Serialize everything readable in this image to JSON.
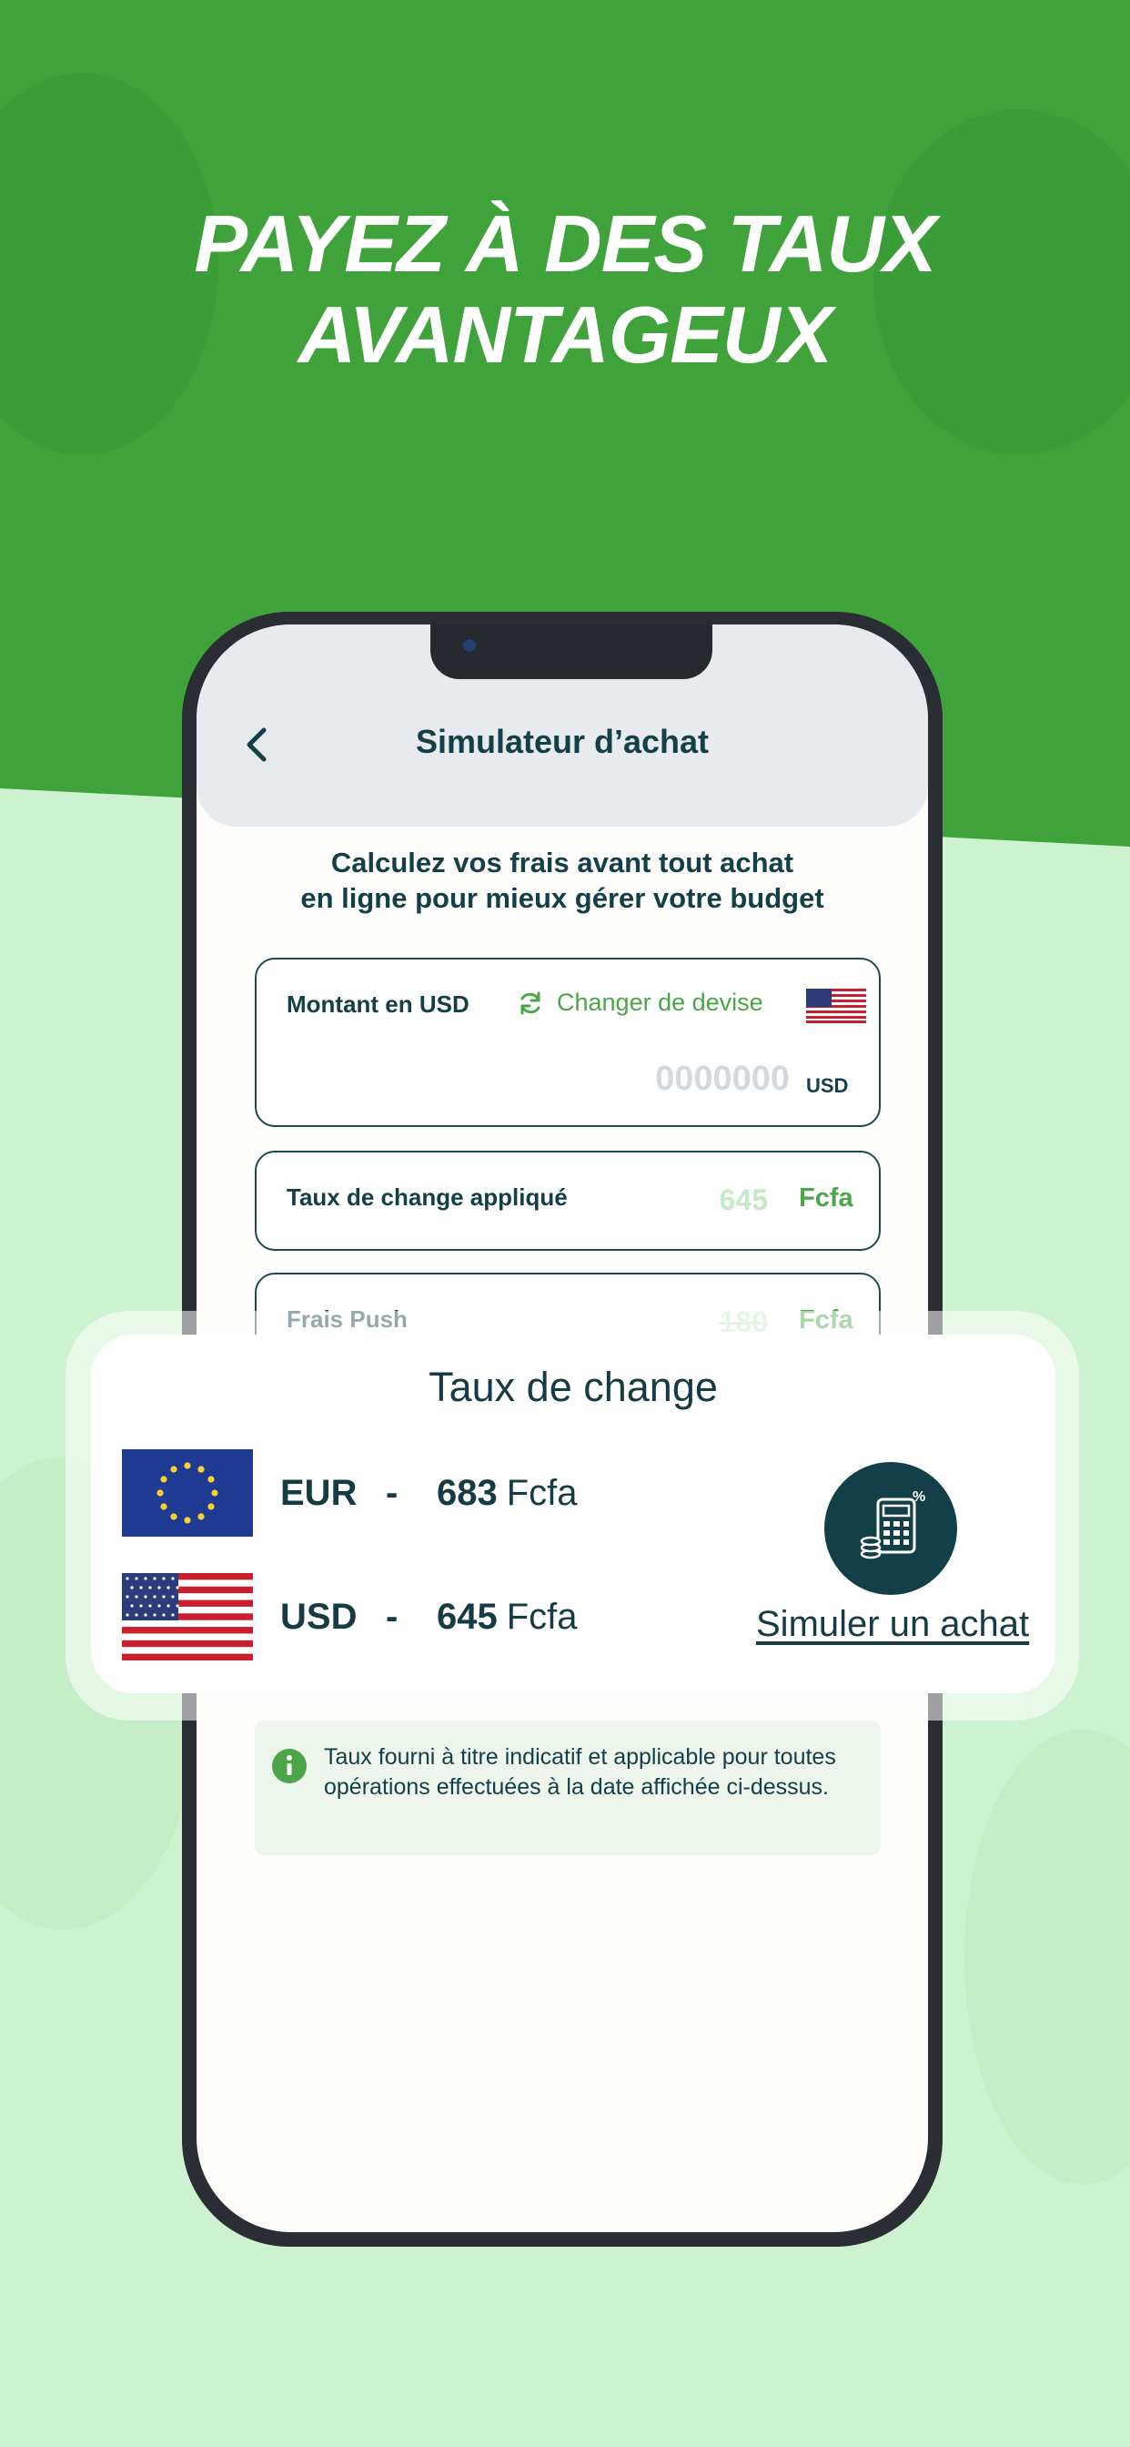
{
  "headline": {
    "line1": "PAYEZ À DES TAUX",
    "line2": "AVANTAGEUX"
  },
  "appbar": {
    "title": "Simulateur d’achat"
  },
  "intro": {
    "line1": "Calculez vos frais avant tout achat",
    "line2": "en ligne pour mieux gérer votre budget"
  },
  "amount_field": {
    "label": "Montant en USD",
    "change_currency_label": "Changer de devise",
    "placeholder": "0000000",
    "unit": "USD"
  },
  "rate_field": {
    "label": "Taux de change appliqué",
    "value": "645",
    "unit": "Fcfa"
  },
  "fees_field": {
    "label": "Frais Push",
    "value": "180",
    "unit": "Fcfa"
  },
  "info_note": "Taux fourni à titre indicatif et applicable pour toutes opérations effectuées à la date affichée ci-dessus.",
  "rates_card": {
    "title": "Taux de change",
    "rows": [
      {
        "code": "EUR",
        "separator": "-",
        "value": "683",
        "unit": "Fcfa",
        "flag": "eu-flag"
      },
      {
        "code": "USD",
        "separator": "-",
        "value": "645",
        "unit": "Fcfa",
        "flag": "us-flag"
      }
    ],
    "simulate_label": "Simuler un achat",
    "icon": "calculator-icon"
  },
  "colors": {
    "brand_green": "#3fa23a",
    "light_green_bg": "#cdf2cf",
    "dark_teal": "#133f48",
    "accent_green": "#4aa648"
  }
}
